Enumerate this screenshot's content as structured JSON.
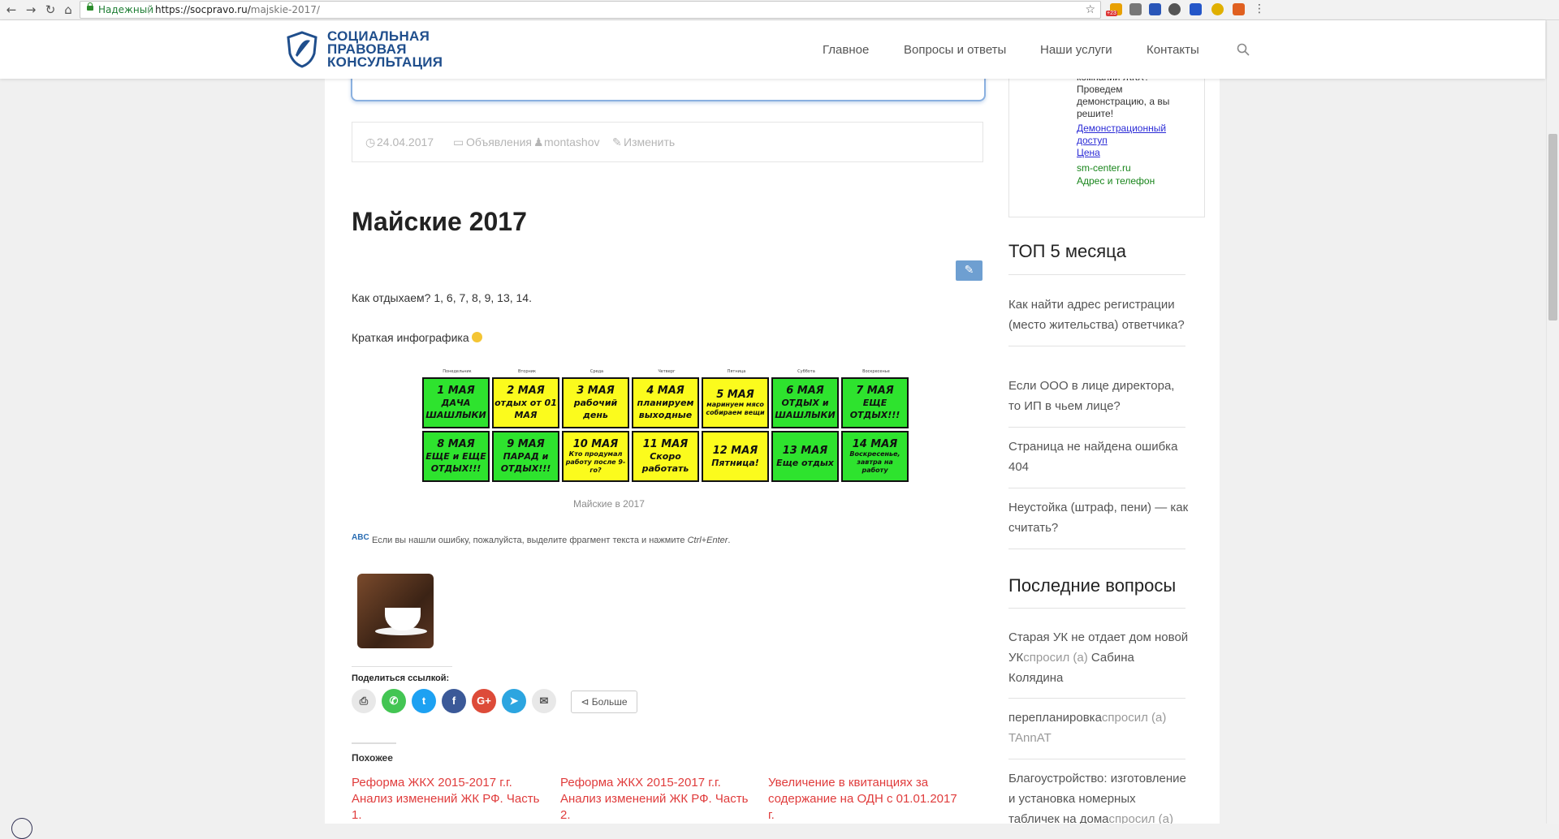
{
  "browser": {
    "secure_label": "Надежный",
    "url_host": "https://socpravo.ru/",
    "url_path": "majskie-2017/",
    "badge": "+23"
  },
  "site": {
    "logo_lines": [
      "СОЦИАЛЬНАЯ",
      "ПРАВОВАЯ",
      "КОНСУЛЬТАЦИЯ"
    ],
    "nav": [
      "Главное",
      "Вопросы и ответы",
      "Наши услуги",
      "Контакты"
    ]
  },
  "post": {
    "date": "24.04.2017",
    "category": "Объявления",
    "author": "montashov",
    "edit": "Изменить",
    "title": "Майские 2017",
    "para1_text": "Как отдыхаем? ",
    "para1_days": "1, 6, 7, 8, 9, 13, 14.",
    "para2": "Краткая инфографика",
    "caption": "Майские в 2017",
    "error_notice_prefix": "Если вы нашли ошибку, пожалуйста, выделите фрагмент текста и нажмите ",
    "error_notice_keys": "Ctrl+Enter",
    "error_notice_suffix": ".",
    "error_icon": "ABC",
    "share_title": "Поделиться ссылкой:",
    "share_more": "Больше",
    "related_title": "Похожее",
    "related": [
      "Реформа ЖКХ 2015-2017 г.г. Анализ изменений ЖК РФ. Часть 1.",
      "Реформа ЖКХ 2015-2017 г.г. Анализ изменений ЖК РФ. Часть 2.",
      "Увеличение в квитанциях за содержание на ОДН с 01.01.2017 г."
    ]
  },
  "calendar": {
    "weekdays": [
      "Понедельник",
      "Вторник",
      "Среда",
      "Четверг",
      "Пятница",
      "Суббота",
      "Воскресенье"
    ],
    "cells": [
      {
        "l1": "1 МАЯ",
        "l2": "ДАЧА ШАШЛЫКИ",
        "color": "g"
      },
      {
        "l1": "2 МАЯ",
        "l2": "отдых от 01 МАЯ",
        "color": "y"
      },
      {
        "l1": "3 МАЯ",
        "l2": "рабочий день",
        "color": "y"
      },
      {
        "l1": "4 МАЯ",
        "l2": "планируем выходные",
        "color": "y"
      },
      {
        "l1": "5 МАЯ",
        "l2": "маринуем мясо собираем вещи",
        "color": "y"
      },
      {
        "l1": "6 МАЯ",
        "l2": "ОТДЫХ и ШАШЛЫКИ",
        "color": "g"
      },
      {
        "l1": "7 МАЯ",
        "l2": "ЕЩЕ ОТДЫХ!!!",
        "color": "g"
      },
      {
        "l1": "8 МАЯ",
        "l2": "ЕЩЕ и ЕЩЕ ОТДЫХ!!!",
        "color": "g"
      },
      {
        "l1": "9 МАЯ",
        "l2": "ПАРАД и ОТДЫХ!!!",
        "color": "g"
      },
      {
        "l1": "10 МАЯ",
        "l2": "Кто продумал работу после 9-го?",
        "color": "y"
      },
      {
        "l1": "11 МАЯ",
        "l2": "Скоро работать",
        "color": "y"
      },
      {
        "l1": "12 МАЯ",
        "l2": "Пятница!",
        "color": "y"
      },
      {
        "l1": "13 МАЯ",
        "l2": "Еще отдых",
        "color": "g"
      },
      {
        "l1": "14 МАЯ",
        "l2": "Воскресенье, завтра на работу",
        "color": "g"
      }
    ]
  },
  "sidebar": {
    "widget_lines": [
      "компании ЖКХ?",
      "Проведем",
      "демонстрацию, а вы",
      "решите!"
    ],
    "widget_links": [
      "Демонстрационный",
      "доступ",
      "Цена"
    ],
    "widget_green": [
      "sm-center.ru",
      "Адрес и телефон"
    ],
    "top5_title": "ТОП 5 месяца",
    "top5": [
      "Как найти адрес регистрации (место жительства) ответчика?",
      "Если ООО в лице директора, то ИП в чьем лице?",
      "Страница не найдена ошибка 404",
      "Неустойка (штраф, пени) — как считать?"
    ],
    "recent_title": "Последние вопросы",
    "recent": [
      {
        "q": "Старая УК не отдает дом новой УК",
        "meta": "спросил (а) ",
        "user": "Сабина Колядина"
      },
      {
        "q": "перепланировка",
        "meta": "спросил (а) ",
        "user": "TAnnAT"
      },
      {
        "q": "Благоустройство: изготовление и установка номерных табличек на дома",
        "meta": "спросил (а)",
        "user": ""
      }
    ]
  }
}
